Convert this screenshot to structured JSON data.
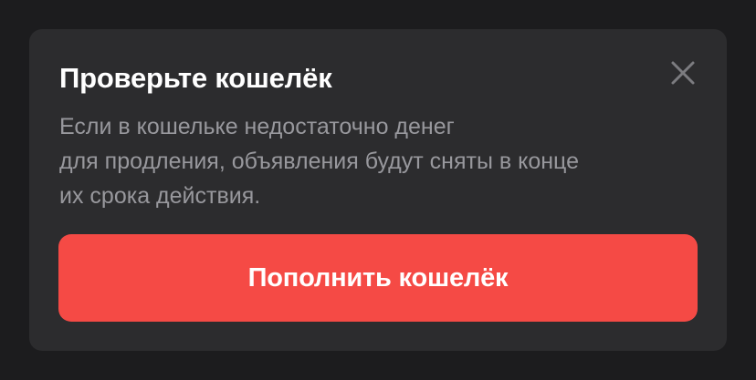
{
  "dialog": {
    "title": "Проверьте кошелёк",
    "close_icon": "close-icon",
    "description_lines": [
      "Если в кошельке недостаточно денег",
      "для продления, объявления будут сняты в конце",
      "их срока действия."
    ],
    "button_label": "Пополнить кошелёк"
  },
  "colors": {
    "background": "#1c1c1e",
    "card": "#2c2c2e",
    "title": "#ffffff",
    "description": "#98989d",
    "close_icon": "#7c7c80",
    "button": "#f54a45",
    "button_text": "#ffffff"
  }
}
